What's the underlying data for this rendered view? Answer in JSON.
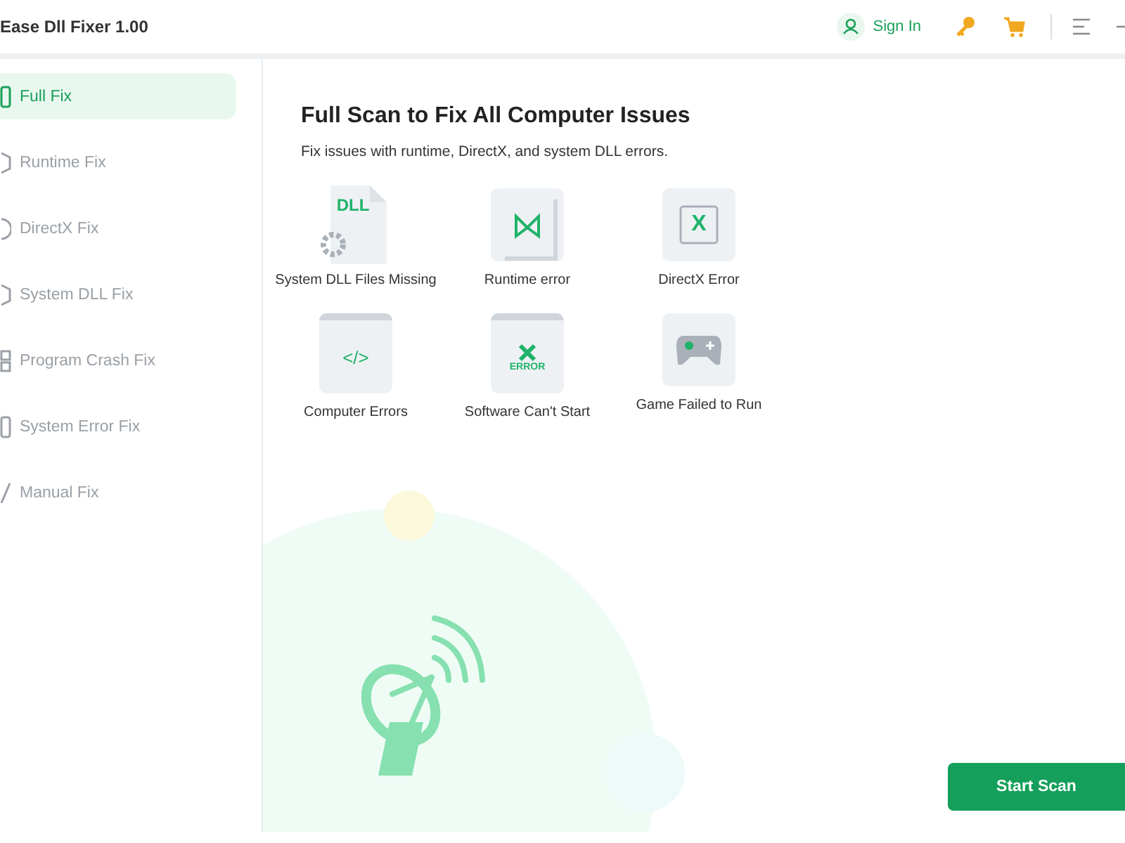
{
  "window": {
    "title": "Ease Dll Fixer  1.00"
  },
  "header": {
    "sign_in": "Sign In"
  },
  "sidebar": {
    "items": [
      {
        "label": "Full Fix",
        "kind": "monitor",
        "selected": true
      },
      {
        "label": "Runtime Fix",
        "kind": "hex",
        "selected": false
      },
      {
        "label": "DirectX Fix",
        "kind": "circle",
        "selected": false
      },
      {
        "label": "System DLL Fix",
        "kind": "gear",
        "selected": false
      },
      {
        "label": "Program Crash Fix",
        "kind": "grid",
        "selected": false
      },
      {
        "label": "System Error Fix",
        "kind": "monitor",
        "selected": false
      },
      {
        "label": "Manual Fix",
        "kind": "pen",
        "selected": false
      }
    ]
  },
  "main": {
    "title": "Full Scan to Fix All Computer Issues",
    "subtitle": "Fix issues with runtime, DirectX, and system DLL errors.",
    "issues": [
      {
        "label": "System DLL Files Missing",
        "kind": "dll",
        "badge": "DLL"
      },
      {
        "label": "Runtime error",
        "kind": "runtime"
      },
      {
        "label": "DirectX Error",
        "kind": "directx",
        "badge": "X"
      },
      {
        "label": "Computer Errors",
        "kind": "code",
        "badge": "</>"
      },
      {
        "label": "Software Can't Start",
        "kind": "error",
        "badge": "ERROR"
      },
      {
        "label": "Game Failed to Run",
        "kind": "game"
      }
    ],
    "start_button": "Start Scan"
  }
}
